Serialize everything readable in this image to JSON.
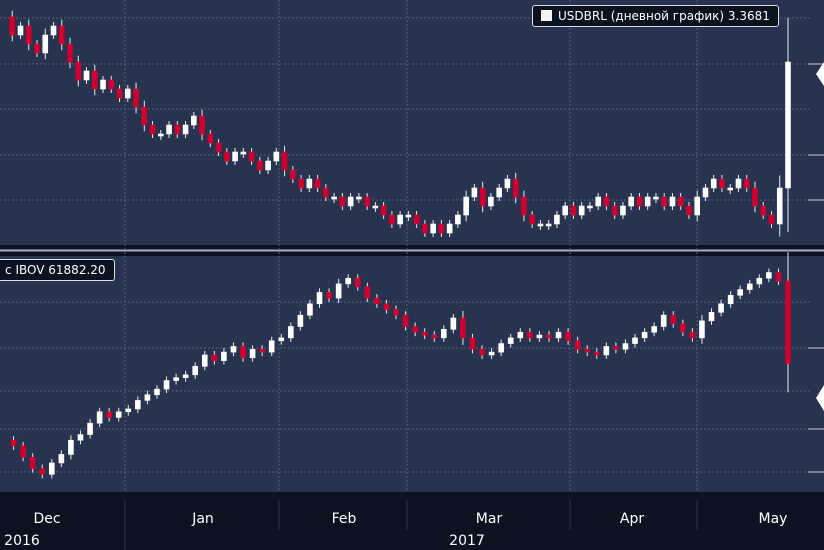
{
  "chart_data": [
    {
      "type": "candlestick",
      "series_name": "USDBRL (дневной график)",
      "last_value": "3.3681",
      "colors": {
        "up_body": "#ffffff",
        "down_body": "#d1002e",
        "wick": "#ffffff",
        "background": "#28344f"
      },
      "ohlc_closes": [
        3.42,
        3.4,
        3.41,
        3.39,
        3.38,
        3.4,
        3.41,
        3.39,
        3.37,
        3.35,
        3.36,
        3.34,
        3.35,
        3.34,
        3.33,
        3.34,
        3.32,
        3.3,
        3.29,
        3.29,
        3.3,
        3.29,
        3.3,
        3.31,
        3.29,
        3.28,
        3.27,
        3.26,
        3.27,
        3.27,
        3.26,
        3.25,
        3.26,
        3.27,
        3.25,
        3.24,
        3.23,
        3.24,
        3.23,
        3.22,
        3.22,
        3.21,
        3.22,
        3.22,
        3.21,
        3.21,
        3.2,
        3.19,
        3.2,
        3.2,
        3.19,
        3.18,
        3.19,
        3.18,
        3.19,
        3.2,
        3.22,
        3.23,
        3.21,
        3.22,
        3.23,
        3.24,
        3.22,
        3.2,
        3.19,
        3.19,
        3.19,
        3.2,
        3.21,
        3.2,
        3.21,
        3.21,
        3.22,
        3.21,
        3.2,
        3.21,
        3.22,
        3.21,
        3.22,
        3.22,
        3.21,
        3.22,
        3.21,
        3.2,
        3.22,
        3.23,
        3.24,
        3.23,
        3.23,
        3.24,
        3.23,
        3.21,
        3.2,
        3.19,
        3.23,
        3.37
      ]
    },
    {
      "type": "candlestick",
      "series_name": "IBOV",
      "label_prefix": "c",
      "last_value": "61882.20",
      "colors": {
        "up_body": "#ffffff",
        "down_body": "#d1002e",
        "wick": "#ffffff",
        "background": "#28344f"
      },
      "ohlc_closes": [
        59200,
        59000,
        58600,
        58200,
        58000,
        58400,
        58700,
        59200,
        59400,
        59800,
        60200,
        60000,
        60200,
        60300,
        60600,
        60800,
        61000,
        61300,
        61400,
        61500,
        61800,
        62200,
        62000,
        62300,
        62500,
        62100,
        62400,
        62300,
        62700,
        62800,
        63200,
        63600,
        64000,
        64400,
        64200,
        64700,
        64900,
        64600,
        64200,
        64000,
        63800,
        63600,
        63200,
        63000,
        62900,
        62800,
        63100,
        63500,
        62800,
        62400,
        62200,
        62300,
        62600,
        62800,
        63000,
        62800,
        62900,
        62800,
        63000,
        62700,
        62400,
        62300,
        62200,
        62500,
        62400,
        62600,
        62800,
        63000,
        63200,
        63600,
        63300,
        63000,
        62800,
        63400,
        63700,
        64000,
        64300,
        64500,
        64700,
        64900,
        65100,
        64800,
        61900
      ]
    }
  ],
  "x_axis": {
    "month_labels": [
      "Dec",
      "Jan",
      "Feb",
      "Mar",
      "Apr",
      "May"
    ],
    "year_labels": [
      "2016",
      "2017"
    ]
  }
}
